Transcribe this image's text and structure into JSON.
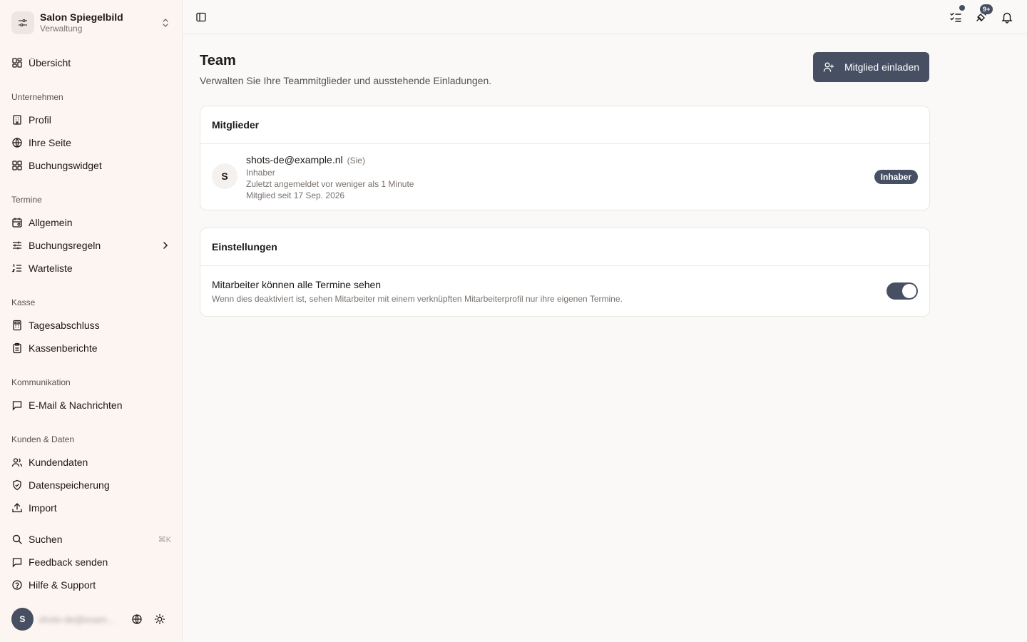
{
  "org": {
    "name": "Salon Spiegelbild",
    "role": "Verwaltung"
  },
  "nav": {
    "overview": "Übersicht",
    "sections": {
      "company": "Unternehmen",
      "appointments": "Termine",
      "cash": "Kasse",
      "communication": "Kommunikation",
      "customers": "Kunden & Daten"
    },
    "profile": "Profil",
    "your_page": "Ihre Seite",
    "booking_widget": "Buchungswidget",
    "general": "Allgemein",
    "booking_rules": "Buchungsregeln",
    "waitlist": "Warteliste",
    "daily_closing": "Tagesabschluss",
    "cash_reports": "Kassenberichte",
    "email_messages": "E-Mail & Nachrichten",
    "customer_data": "Kundendaten",
    "data_storage": "Datenspeicherung",
    "import": "Import",
    "search": "Suchen",
    "search_shortcut": "⌘K",
    "feedback": "Feedback senden",
    "help": "Hilfe & Support"
  },
  "user": {
    "initial": "S",
    "email": "shots-de@exam..."
  },
  "topbar": {
    "notification_badge": "9+"
  },
  "page": {
    "title": "Team",
    "subtitle": "Verwalten Sie Ihre Teammitglieder und ausstehende Einladungen.",
    "invite_label": "Mitglied einladen"
  },
  "members": {
    "heading": "Mitglieder",
    "items": [
      {
        "initial": "S",
        "email": "shots-de@example.nl",
        "you_label": "(Sie)",
        "role": "Inhaber",
        "last_login": "Zuletzt angemeldet vor weniger als 1 Minute",
        "member_since": "Mitglied seit 17 Sep. 2026",
        "badge": "Inhaber"
      }
    ]
  },
  "settings": {
    "heading": "Einstellungen",
    "items": [
      {
        "title": "Mitarbeiter können alle Termine sehen",
        "description": "Wenn dies deaktiviert ist, sehen Mitarbeiter mit einem verknüpften Mitarbeiterprofil nur ihre eigenen Termine.",
        "enabled": true
      }
    ]
  },
  "colors": {
    "accent": "#475063",
    "sidebar_bg": "#fdf5f1",
    "page_bg": "#faf9f7"
  }
}
